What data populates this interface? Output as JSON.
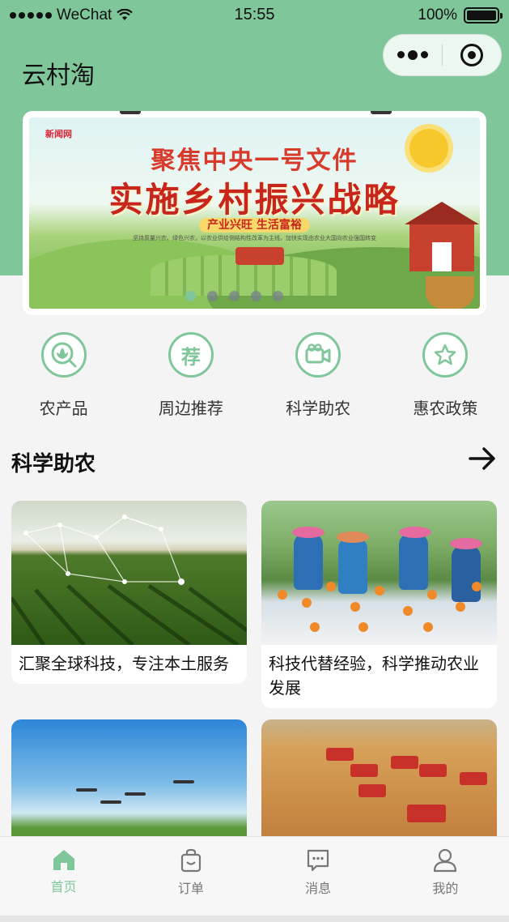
{
  "status_bar": {
    "carrier": "WeChat",
    "time": "15:55",
    "battery": "100%"
  },
  "nav": {
    "title": "云村淘",
    "icons": [
      "more-dots-icon",
      "close-target-icon"
    ]
  },
  "banner": {
    "logo_text": "新闻网",
    "subtitle": "聚焦中央一号文件",
    "headline": "实施乡村振兴战略",
    "tagline": "产业兴旺 生活富裕",
    "note": "坚持质量兴农、绿色兴农，以农业供给侧结构性改革为主线，加快实现由农业大国向农业强国转变",
    "dot_count": 5,
    "active_dot": 0,
    "accent": "#7fc69a"
  },
  "categories": [
    {
      "label": "农产品",
      "icon": "leaf-search-icon"
    },
    {
      "label": "周边推荐",
      "icon": "recommend-icon",
      "glyph": "荐"
    },
    {
      "label": "科学助农",
      "icon": "video-camera-icon"
    },
    {
      "label": "惠农政策",
      "icon": "star-icon"
    }
  ],
  "section": {
    "title": "科学助农",
    "more_icon": "arrow-right-icon"
  },
  "cards": [
    {
      "title": "汇聚全球科技，专注本土服务",
      "image": "smart-farm-field-photo"
    },
    {
      "title": "科技代替经验，科学推动农业发展",
      "image": "orange-harvest-photo"
    },
    {
      "title": "",
      "image": "drone-spraying-photo"
    },
    {
      "title": "",
      "image": "wheat-harvest-photo"
    }
  ],
  "tabbar": [
    {
      "label": "首页",
      "icon": "home-icon",
      "active": true
    },
    {
      "label": "订单",
      "icon": "shopping-bag-icon",
      "active": false
    },
    {
      "label": "消息",
      "icon": "message-icon",
      "active": false
    },
    {
      "label": "我的",
      "icon": "user-icon",
      "active": false
    }
  ],
  "colors": {
    "theme_green": "#7fc69a",
    "page_bg": "#f4f4f4",
    "tab_inactive": "#777777"
  }
}
